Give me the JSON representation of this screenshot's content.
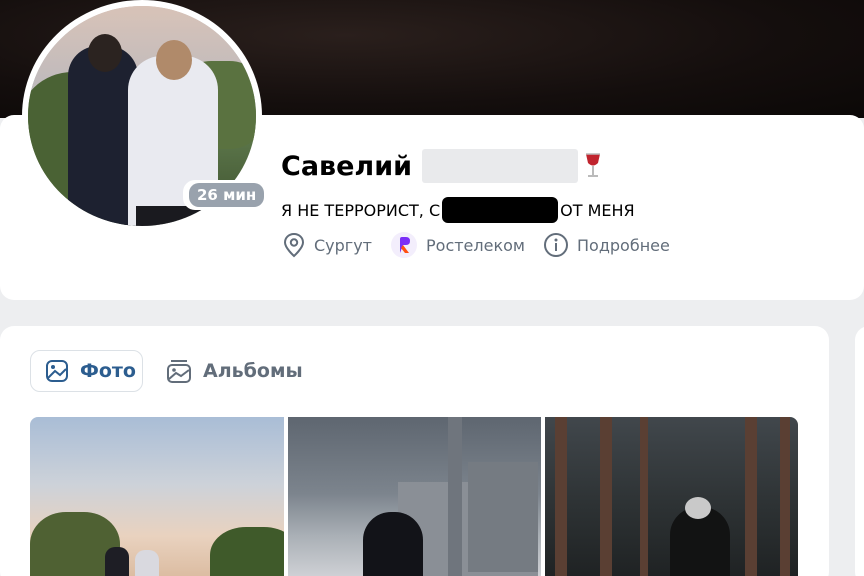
{
  "profile": {
    "name": "Савелий",
    "online_badge": "26 мин",
    "status_prefix": "Я НЕ ТЕРРОРИСТ, С",
    "status_suffix": "ОТ МЕНЯ",
    "info": {
      "city": "Сургут",
      "work": "Ростелеком",
      "more": "Подробнее"
    },
    "icons": {
      "city_icon": "location-pin-icon",
      "work_icon": "rostelecom-logo-icon",
      "more_icon": "info-icon",
      "name_emoji": "wine-glass-icon"
    }
  },
  "photos": {
    "tabs": [
      {
        "label": "Фото",
        "icon": "photo-icon",
        "active": true
      },
      {
        "label": "Альбомы",
        "icon": "albums-icon",
        "active": false
      }
    ],
    "thumbnail_count": 3
  },
  "colors": {
    "accent": "#2c5d8f",
    "secondary_text": "#626d7a",
    "page_bg": "#edeef0",
    "badge": "#99a2ad"
  }
}
